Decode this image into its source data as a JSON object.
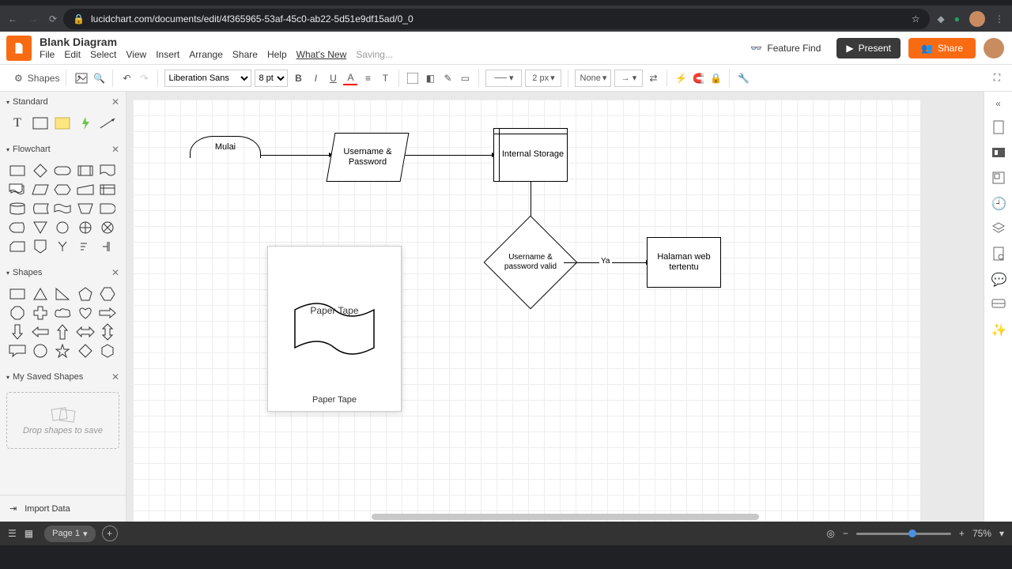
{
  "browser": {
    "url": "lucidchart.com/documents/edit/4f365965-53af-45c0-ab22-5d51e9df15ad/0_0"
  },
  "header": {
    "title": "Blank Diagram",
    "menu": [
      "File",
      "Edit",
      "Select",
      "View",
      "Insert",
      "Arrange",
      "Share",
      "Help"
    ],
    "whats_new": "What's New",
    "saving": "Saving...",
    "feature_find": "Feature Find",
    "present": "Present",
    "share": "Share"
  },
  "toolbar": {
    "shapes": "Shapes",
    "font": "Liberation Sans",
    "font_size": "8 pt",
    "line_width": "2 px",
    "fill": "None"
  },
  "panels": {
    "standard": "Standard",
    "flowchart": "Flowchart",
    "shapes": "Shapes",
    "saved": "My Saved Shapes",
    "drop_hint": "Drop shapes to save",
    "import": "Import Data"
  },
  "tooltip": {
    "big_label": "Paper Tape",
    "caption": "Paper Tape"
  },
  "canvas": {
    "start": "Mulai",
    "input": "Username & Password",
    "storage": "Internal Storage",
    "decision": "Username & password valid",
    "decision_yes": "Ya",
    "page": "Halaman web tertentu"
  },
  "status": {
    "page_label": "Page 1",
    "zoom": "75%"
  }
}
